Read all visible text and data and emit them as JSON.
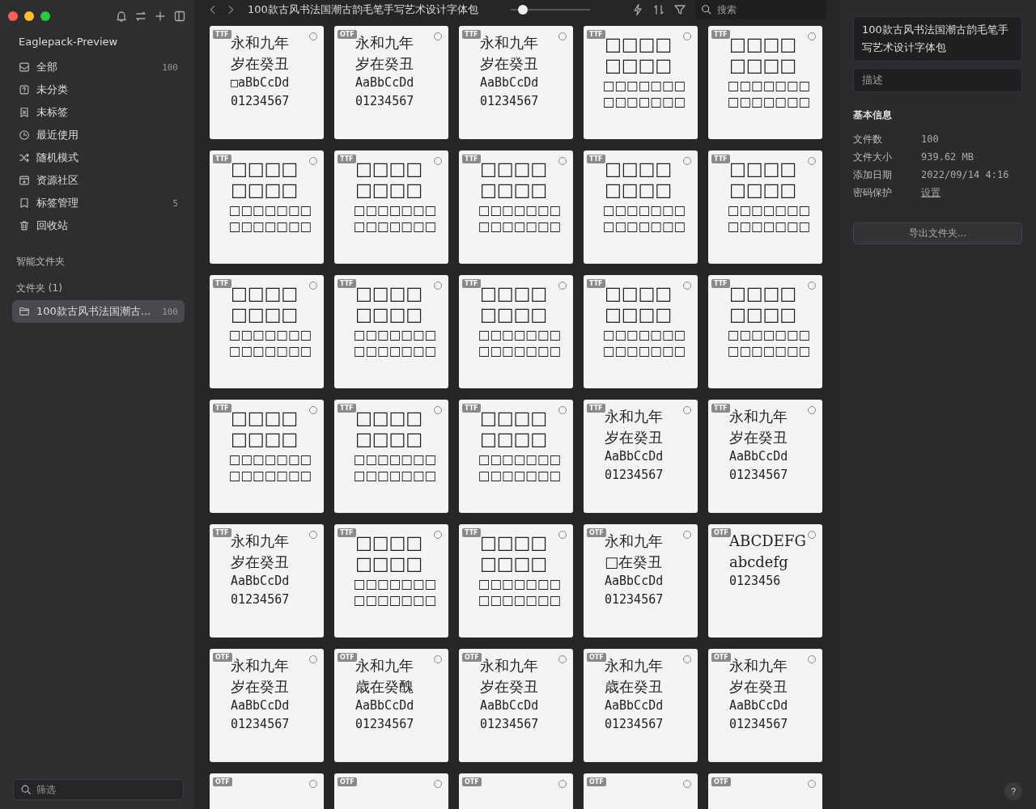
{
  "sidebar": {
    "library": "Eaglepack-Preview",
    "items": [
      {
        "label": "全部",
        "count": "100",
        "selected": false
      },
      {
        "label": "未分类",
        "selected": false
      },
      {
        "label": "未标签",
        "selected": false
      },
      {
        "label": "最近使用",
        "selected": false
      },
      {
        "label": "随机模式",
        "selected": false
      },
      {
        "label": "资源社区",
        "selected": false
      },
      {
        "label": "标签管理",
        "count": "5",
        "selected": false
      },
      {
        "label": "回收站",
        "selected": false
      }
    ],
    "sections": [
      "智能文件夹",
      "文件夹 (1)"
    ],
    "folders": [
      {
        "label": "100款古风书法国潮古...",
        "count": "100",
        "selected": true
      }
    ],
    "filter": {
      "placeholder": "筛选"
    }
  },
  "toolbar": {
    "title": "100款古风书法国潮古韵毛笔手写艺术设计字体包",
    "zoom": {
      "level": 0.15
    },
    "search": {
      "placeholder": "搜索"
    }
  },
  "cards": [
    {
      "format": "TTF",
      "selected": false,
      "lines": [
        "永和九年",
        "岁在癸丑",
        "□aBbCcDd",
        "01234567"
      ]
    },
    {
      "format": "OTF",
      "selected": false,
      "lines": [
        "永和九年",
        "岁在癸丑",
        "AaBbCcDd",
        "01234567"
      ]
    },
    {
      "format": "TTF",
      "selected": false,
      "lines": [
        "永和九年",
        "岁在癸丑",
        "AaBbCcDd",
        "01234567"
      ]
    },
    {
      "format": "TTF",
      "selected": false,
      "lines": [
        "□□□□",
        "□□□□",
        "□□□□□□□",
        "□□□□□□□"
      ]
    },
    {
      "format": "TTF",
      "selected": false,
      "lines": [
        "□□□□",
        "□□□□",
        "□□□□□□□",
        "□□□□□□□"
      ]
    },
    {
      "format": "TTF",
      "selected": false,
      "lines": [
        "□□□□",
        "□□□□",
        "□□□□□□□",
        "□□□□□□□"
      ]
    },
    {
      "format": "TTF",
      "selected": false,
      "lines": [
        "□□□□",
        "□□□□",
        "□□□□□□□",
        "□□□□□□□"
      ]
    },
    {
      "format": "TTF",
      "selected": false,
      "lines": [
        "□□□□",
        "□□□□",
        "□□□□□□□",
        "□□□□□□□"
      ]
    },
    {
      "format": "TTF",
      "selected": false,
      "lines": [
        "□□□□",
        "□□□□",
        "□□□□□□□",
        "□□□□□□□"
      ]
    },
    {
      "format": "TTF",
      "selected": false,
      "lines": [
        "□□□□",
        "□□□□",
        "□□□□□□□",
        "□□□□□□□"
      ]
    },
    {
      "format": "TTF",
      "selected": false,
      "lines": [
        "□□□□",
        "□□□□",
        "□□□□□□□",
        "□□□□□□□"
      ]
    },
    {
      "format": "TTF",
      "selected": false,
      "lines": [
        "□□□□",
        "□□□□",
        "□□□□□□□",
        "□□□□□□□"
      ]
    },
    {
      "format": "TTF",
      "selected": false,
      "lines": [
        "□□□□",
        "□□□□",
        "□□□□□□□",
        "□□□□□□□"
      ]
    },
    {
      "format": "TTF",
      "selected": false,
      "lines": [
        "□□□□",
        "□□□□",
        "□□□□□□□",
        "□□□□□□□"
      ]
    },
    {
      "format": "TTF",
      "selected": false,
      "lines": [
        "□□□□",
        "□□□□",
        "□□□□□□□",
        "□□□□□□□"
      ]
    },
    {
      "format": "TTF",
      "selected": false,
      "lines": [
        "□□□□",
        "□□□□",
        "□□□□□□□",
        "□□□□□□□"
      ]
    },
    {
      "format": "TTF",
      "selected": false,
      "lines": [
        "□□□□",
        "□□□□",
        "□□□□□□□",
        "□□□□□□□"
      ]
    },
    {
      "format": "TTF",
      "selected": false,
      "lines": [
        "□□□□",
        "□□□□",
        "□□□□□□□",
        "□□□□□□□"
      ]
    },
    {
      "format": "TTF",
      "selected": false,
      "lines": [
        "永和九年",
        "岁在癸丑",
        "AaBbCcDd",
        "01234567"
      ]
    },
    {
      "format": "TTF",
      "selected": false,
      "lines": [
        "永和九年",
        "岁在癸丑",
        "AaBbCcDd",
        "01234567"
      ]
    },
    {
      "format": "TTF",
      "selected": false,
      "lines": [
        "永和九年",
        "岁在癸丑",
        "AaBbCcDd",
        "01234567"
      ]
    },
    {
      "format": "TTF",
      "selected": false,
      "lines": [
        "□□□□",
        "□□□□",
        "□□□□□□□",
        "□□□□□□□"
      ]
    },
    {
      "format": "TTF",
      "selected": false,
      "lines": [
        "□□□□",
        "□□□□",
        "□□□□□□□",
        "□□□□□□□"
      ]
    },
    {
      "format": "OTF",
      "selected": false,
      "lines": [
        "永和九年",
        "□在癸丑",
        "AaBbCcDd",
        "01234567"
      ]
    },
    {
      "format": "OTF",
      "selected": false,
      "lines": [
        "ABCDEFG",
        "abcdefg",
        "0123456"
      ]
    },
    {
      "format": "OTF",
      "selected": false,
      "lines": [
        "永和九年",
        "岁在癸丑",
        "AaBbCcDd",
        "01234567"
      ]
    },
    {
      "format": "OTF",
      "selected": false,
      "lines": [
        "永和九年",
        "歳在癸醜",
        "AaBbCcDd",
        "01234567"
      ]
    },
    {
      "format": "OTF",
      "selected": false,
      "lines": [
        "永和九年",
        "岁在癸丑",
        "AaBbCcDd",
        "01234567"
      ]
    },
    {
      "format": "OTF",
      "selected": false,
      "lines": [
        "永和九年",
        "歳在癸丑",
        "AaBbCcDd",
        "01234567"
      ]
    },
    {
      "format": "OTF",
      "selected": false,
      "lines": [
        "永和九年",
        "岁在癸丑",
        "AaBbCcDd",
        "01234567"
      ]
    },
    {
      "format": "OTF",
      "selected": false
    },
    {
      "format": "OTF",
      "selected": false
    },
    {
      "format": "OTF",
      "selected": false
    },
    {
      "format": "OTF",
      "selected": false
    },
    {
      "format": "OTF",
      "selected": false
    }
  ],
  "inspector": {
    "name": "100款古风书法国潮古韵毛笔手写艺术设计字体包",
    "description": {
      "placeholder": "描述"
    },
    "section": "基本信息",
    "rows": [
      {
        "label": "文件数",
        "value": "100",
        "kind": "text"
      },
      {
        "label": "文件大小",
        "value": "939.62 MB",
        "kind": "text"
      },
      {
        "label": "添加日期",
        "value": "2022/09/14 4:16",
        "kind": "text"
      },
      {
        "label": "密码保护",
        "value": "设置",
        "kind": "link"
      }
    ],
    "button": "导出文件夹...",
    "help": "?"
  }
}
